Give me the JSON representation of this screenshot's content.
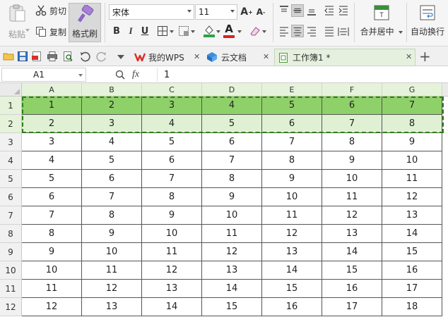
{
  "ribbon": {
    "paste_label": "粘贴",
    "cut_label": "剪切",
    "copy_label": "复制",
    "format_painter_label": "格式刷",
    "font_name": "宋体",
    "font_size": "11",
    "bold": "B",
    "italic": "I",
    "underline": "U",
    "merge_center_label": "合并居中",
    "wrap_label": "自动换行"
  },
  "tabs": [
    {
      "label": "我的WPS"
    },
    {
      "label": "云文档"
    },
    {
      "label": "工作簿1 *"
    }
  ],
  "formula_bar": {
    "name_box": "A1",
    "fx": "fx",
    "value": "1"
  },
  "grid": {
    "columns": [
      "A",
      "B",
      "C",
      "D",
      "E",
      "F",
      "G"
    ],
    "row_numbers": [
      "1",
      "2",
      "3",
      "4",
      "5",
      "6",
      "7",
      "8",
      "9",
      "10",
      "11",
      "12"
    ],
    "rows": [
      [
        "1",
        "2",
        "3",
        "4",
        "5",
        "6",
        "7"
      ],
      [
        "2",
        "3",
        "4",
        "5",
        "6",
        "7",
        "8"
      ],
      [
        "3",
        "4",
        "5",
        "6",
        "7",
        "8",
        "9"
      ],
      [
        "4",
        "5",
        "6",
        "7",
        "8",
        "9",
        "10"
      ],
      [
        "5",
        "6",
        "7",
        "8",
        "9",
        "10",
        "11"
      ],
      [
        "6",
        "7",
        "8",
        "9",
        "10",
        "11",
        "12"
      ],
      [
        "7",
        "8",
        "9",
        "10",
        "11",
        "12",
        "13"
      ],
      [
        "8",
        "9",
        "10",
        "11",
        "12",
        "13",
        "14"
      ],
      [
        "9",
        "10",
        "11",
        "12",
        "13",
        "14",
        "15"
      ],
      [
        "10",
        "11",
        "12",
        "13",
        "14",
        "15",
        "16"
      ],
      [
        "11",
        "12",
        "13",
        "14",
        "15",
        "16",
        "17"
      ],
      [
        "12",
        "13",
        "14",
        "15",
        "16",
        "17",
        "18"
      ]
    ]
  },
  "colors": {
    "selected_row_1": "#8fd169",
    "selected_row_2": "#dff1d2",
    "marquee": "#2f7d18"
  }
}
